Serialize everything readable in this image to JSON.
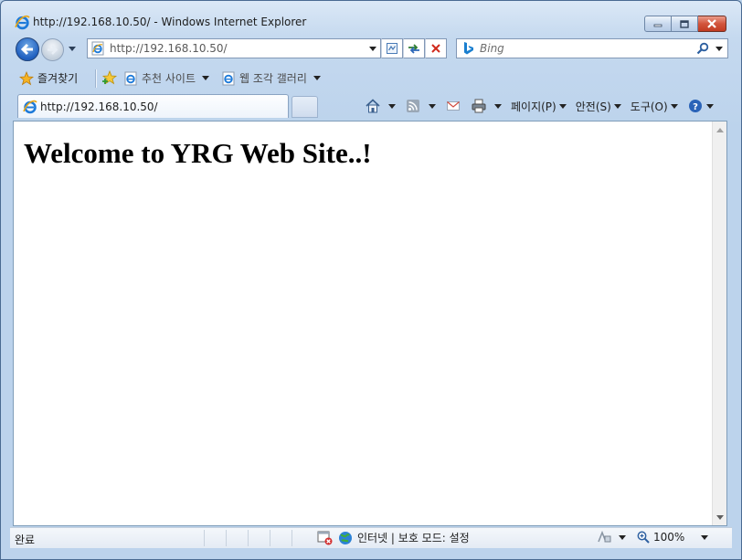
{
  "window": {
    "title": "http://192.168.10.50/ - Windows Internet Explorer",
    "minimize_icon": "minimize-icon",
    "maximize_icon": "maximize-icon",
    "close_icon": "close-icon"
  },
  "navigation": {
    "address": "http://192.168.10.50/",
    "search_placeholder": "Bing"
  },
  "favorites_bar": {
    "favorites_label": "즐겨찾기",
    "items": [
      {
        "label": "추천 사이트"
      },
      {
        "label": "웹 조각 갤러리"
      }
    ]
  },
  "tabs": [
    {
      "label": "http://192.168.10.50/"
    }
  ],
  "command_bar": {
    "page_label": "페이지(P)",
    "safety_label": "안전(S)",
    "tools_label": "도구(O)"
  },
  "page": {
    "heading": "Welcome to YRG Web Site..!"
  },
  "status_bar": {
    "status_text": "완료",
    "zone_text": "인터넷 | 보호 모드: 설정",
    "zoom": "100%"
  },
  "colors": {
    "frame": "#c5d9ef",
    "close_button": "#c23b22",
    "back_button": "#1f5fbf"
  }
}
